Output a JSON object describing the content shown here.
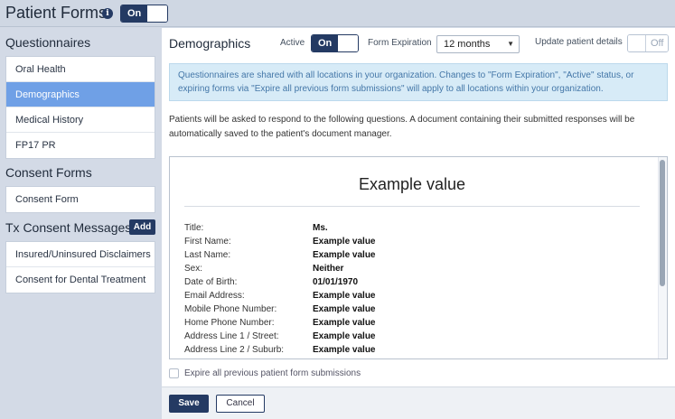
{
  "header": {
    "title": "Patient Forms",
    "toggle_label": "On"
  },
  "sidebar": {
    "questionnaires_heading": "Questionnaires",
    "questionnaires": [
      {
        "label": "Oral Health"
      },
      {
        "label": "Demographics"
      },
      {
        "label": "Medical History"
      },
      {
        "label": "FP17 PR"
      }
    ],
    "consent_heading": "Consent Forms",
    "consent_forms": [
      {
        "label": "Consent Form"
      }
    ],
    "tx_heading": "Tx Consent Messages",
    "tx_add_label": "Add",
    "tx_messages": [
      {
        "label": "Insured/Uninsured Disclaimers"
      },
      {
        "label": "Consent for Dental Treatment"
      }
    ]
  },
  "main": {
    "title": "Demographics",
    "active_label": "Active",
    "active_toggle": "On",
    "expiration_label": "Form Expiration",
    "expiration_value": "12 months",
    "update_label": "Update patient details",
    "update_toggle": "Off",
    "notice": "Questionnaires are shared with all locations in your organization. Changes to \"Form Expiration\", \"Active\" status, or expiring forms via \"Expire all previous form submissions\" will apply to all locations within your organization.",
    "intro": "Patients will be asked to respond to the following questions. A document containing their submitted responses will be automatically saved to the patient's document manager.",
    "preview": {
      "title": "Example value",
      "fields": [
        {
          "label": "Title:",
          "value": "Ms."
        },
        {
          "label": "First Name:",
          "value": "Example value"
        },
        {
          "label": "Last Name:",
          "value": "Example value"
        },
        {
          "label": "Sex:",
          "value": "Neither"
        },
        {
          "label": "Date of Birth:",
          "value": "01/01/1970"
        },
        {
          "label": "Email Address:",
          "value": "Example value"
        },
        {
          "label": "Mobile Phone Number:",
          "value": "Example value"
        },
        {
          "label": "Home Phone Number:",
          "value": "Example value"
        },
        {
          "label": "Address Line 1 / Street:",
          "value": "Example value"
        },
        {
          "label": "Address Line 2 / Suburb:",
          "value": "Example value"
        }
      ]
    },
    "expire_label": "Expire all previous patient form submissions",
    "save_label": "Save",
    "cancel_label": "Cancel"
  },
  "colors": {
    "brand": "#243a63",
    "selected": "#6fa0e6",
    "notice_bg": "#d7ebf7",
    "notice_text": "#4477a8"
  }
}
